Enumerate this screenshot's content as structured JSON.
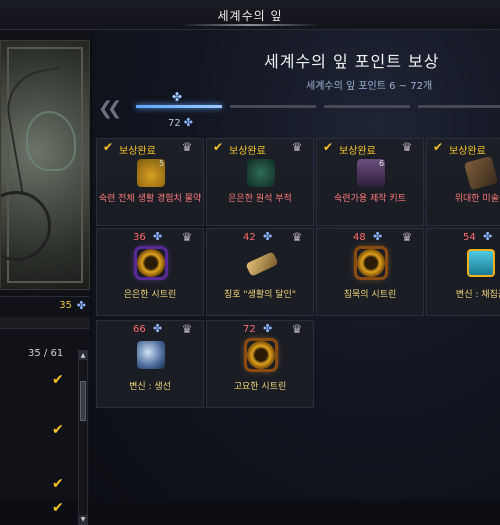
{
  "window": {
    "title": "세계수의 잎"
  },
  "left": {
    "points": "35",
    "progress": "35  /  61",
    "checks": [
      "✔",
      "✔",
      "✔",
      "✔"
    ]
  },
  "panel": {
    "heading": "세계수의 잎 포인트 보상",
    "subheading": "세계수의 잎 포인트 6 ~ 72개",
    "current_label": "72"
  },
  "rewards": [
    {
      "status": "보상완료",
      "points": "",
      "count": "5",
      "name": "숙련 전체 생활 경험치 물약",
      "color": "red",
      "icon": "potion-icon"
    },
    {
      "status": "보상완료",
      "points": "",
      "count": "",
      "name": "은은한 원석 부적",
      "color": "red",
      "icon": "gem-icon"
    },
    {
      "status": "보상완료",
      "points": "",
      "count": "6",
      "name": "숙련가용 제작 키트",
      "color": "red",
      "icon": "kit-icon"
    },
    {
      "status": "보상완료",
      "points": "",
      "count": "",
      "name": "위대한 미술품",
      "color": "red",
      "icon": "scroll-icon"
    },
    {
      "status": "",
      "points": "36",
      "count": "",
      "name": "은은한 시트린",
      "color": "yellow",
      "icon": "ring-icon"
    },
    {
      "status": "",
      "points": "42",
      "count": "",
      "name": "칭호 \"생활의 달인\"",
      "color": "yellow",
      "icon": "title-icon"
    },
    {
      "status": "",
      "points": "48",
      "count": "",
      "name": "침묵의 시트린",
      "color": "yellow",
      "icon": "ring-icon"
    },
    {
      "status": "",
      "points": "54",
      "count": "",
      "name": "변신 : 채집꾼",
      "color": "yellow",
      "icon": "gift-icon"
    },
    {
      "status": "",
      "points": "66",
      "count": "",
      "name": "변신 : 생선",
      "color": "yellow",
      "icon": "fish-icon"
    },
    {
      "status": "",
      "points": "72",
      "count": "",
      "name": "고요한 시트린",
      "color": "yellow",
      "icon": "ring-icon"
    }
  ]
}
